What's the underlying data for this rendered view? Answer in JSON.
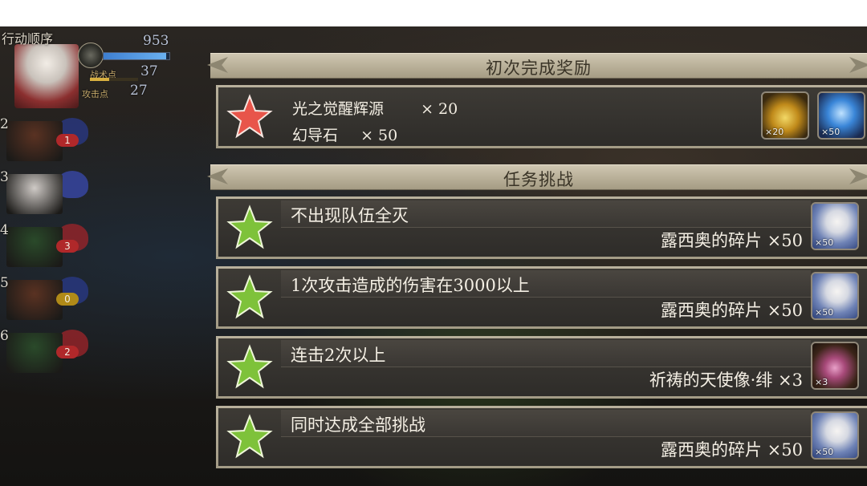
{
  "turn_order": {
    "title": "行动顺序",
    "active_unit": {
      "hp_value": "953",
      "hp_fraction": 0.95,
      "skill_points_label": "战术点",
      "skill_points_value": "37",
      "attack_points_label": "攻击点",
      "attack_points_value": "27"
    },
    "queue": [
      {
        "position": "2",
        "badge": "1",
        "badge_color": "#b0282a",
        "wing_color": "#2a3a8a",
        "portrait_color": "#5a3222"
      },
      {
        "position": "3",
        "badge": "",
        "badge_color": "",
        "wing_color": "#3a4ab0",
        "portrait_color": "#cfcac6"
      },
      {
        "position": "4",
        "badge": "3",
        "badge_color": "#b0282a",
        "wing_color": "#a0242a",
        "portrait_color": "#2a4a2a"
      },
      {
        "position": "5",
        "badge": "0",
        "badge_color": "#b08a18",
        "wing_color": "#2a3a8a",
        "portrait_color": "#5a3222"
      },
      {
        "position": "6",
        "badge": "2",
        "badge_color": "#b0282a",
        "wing_color": "#a0242a",
        "portrait_color": "#2a4a2a"
      }
    ]
  },
  "first_clear": {
    "header": "初次完成奖励",
    "lines": [
      {
        "name": "光之觉醒辉源",
        "qty": "× 20"
      },
      {
        "name": "幻导石",
        "qty": "× 50"
      }
    ],
    "items": [
      {
        "icon": "light-flame-icon",
        "count": "×20"
      },
      {
        "icon": "blue-crystal-icon",
        "count": "×50"
      }
    ]
  },
  "missions": {
    "header": "任务挑战",
    "rows": [
      {
        "title": "不出现队伍全灭",
        "reward": "露西奥的碎片 ×50",
        "icon": "lucio-portrait-icon",
        "count": "×50"
      },
      {
        "title": "1次攻击造成的伤害在3000以上",
        "reward": "露西奥的碎片 ×50",
        "icon": "lucio-portrait-icon",
        "count": "×50"
      },
      {
        "title": "连击2次以上",
        "reward": "祈祷的天使像·绯 ×3",
        "icon": "angel-statue-icon",
        "count": "×3"
      },
      {
        "title": "同时达成全部挑战",
        "reward": "露西奥的碎片 ×50",
        "icon": "lucio-portrait-icon",
        "count": "×50"
      }
    ]
  },
  "colors": {
    "first_clear_star": "#e8554a",
    "mission_star": "#7ec23a"
  }
}
